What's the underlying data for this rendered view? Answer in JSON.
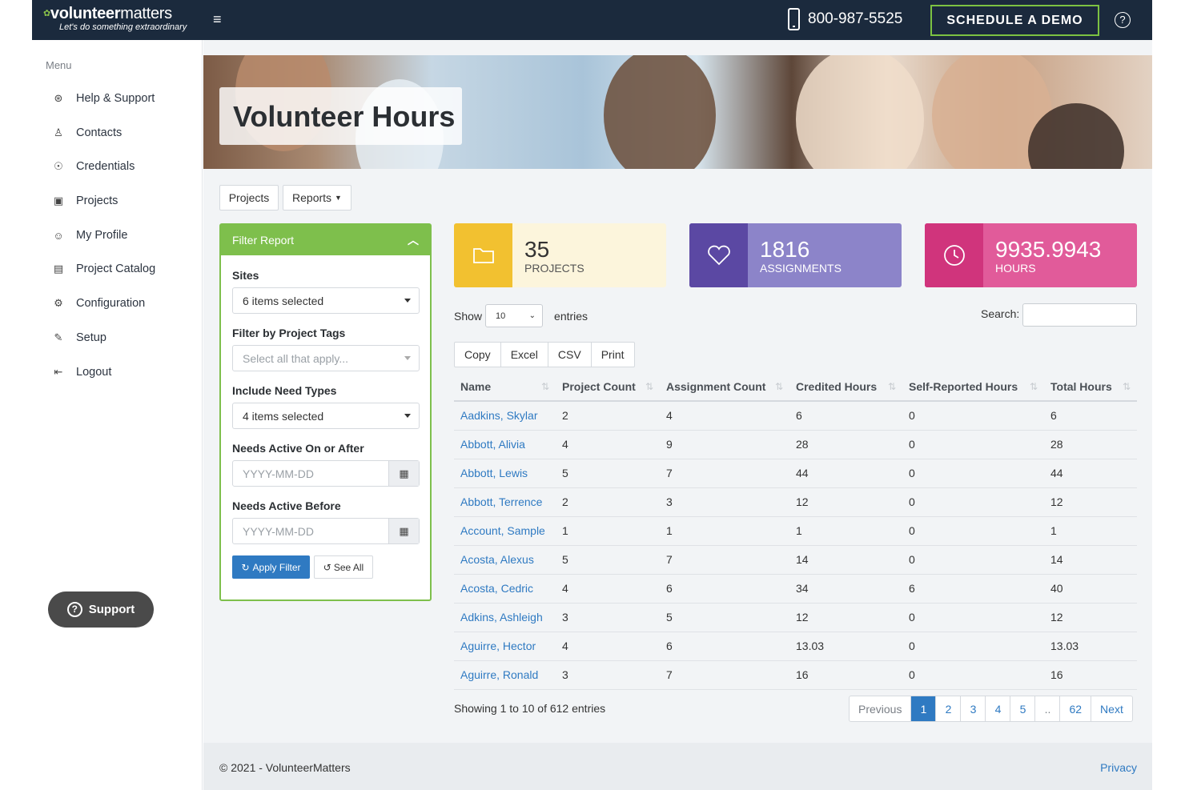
{
  "header": {
    "brand_bold": "volunteer",
    "brand_thin": "matters",
    "tagline": "Let's do something extraordinary",
    "phone": "800-987-5525",
    "demo_label": "SCHEDULE A DEMO",
    "help_symbol": "?"
  },
  "sidebar": {
    "menu_title": "Menu",
    "items": [
      {
        "label": "Help & Support",
        "icon": "lifebuoy-icon"
      },
      {
        "label": "Contacts",
        "icon": "contacts-icon"
      },
      {
        "label": "Credentials",
        "icon": "award-icon"
      },
      {
        "label": "Projects",
        "icon": "briefcase-icon"
      },
      {
        "label": "My Profile",
        "icon": "smiley-icon"
      },
      {
        "label": "Project Catalog",
        "icon": "book-icon"
      },
      {
        "label": "Configuration",
        "icon": "gear-icon"
      },
      {
        "label": "Setup",
        "icon": "wrench-icon"
      },
      {
        "label": "Logout",
        "icon": "logout-icon"
      }
    ],
    "support_label": "Support"
  },
  "page": {
    "title": "Volunteer Hours",
    "nav_projects": "Projects",
    "nav_reports": "Reports"
  },
  "filter": {
    "title": "Filter Report",
    "sites_label": "Sites",
    "sites_value": "6 items selected",
    "tags_label": "Filter by Project Tags",
    "tags_placeholder": "Select all that apply...",
    "need_types_label": "Include Need Types",
    "need_types_value": "4 items selected",
    "active_after_label": "Needs Active On or After",
    "active_before_label": "Needs Active Before",
    "date_placeholder": "YYYY-MM-DD",
    "apply_label": "Apply Filter",
    "see_all_label": "See All"
  },
  "stats": [
    {
      "value": "35",
      "label": "PROJECTS",
      "color": "#f2c130",
      "bg": "#fcf5dc",
      "icon": "folder-icon"
    },
    {
      "value": "1816",
      "label": "ASSIGNMENTS",
      "color": "#5b48a3",
      "bg": "#8c84c9",
      "icon": "heart-icon"
    },
    {
      "value": "9935.9943",
      "label": "HOURS",
      "color": "#d0347c",
      "bg": "#e15b9a",
      "icon": "clock-icon"
    }
  ],
  "table_controls": {
    "show_label": "Show",
    "page_size": "10",
    "entries_label": "entries",
    "search_label": "Search:",
    "export_buttons": [
      "Copy",
      "Excel",
      "CSV",
      "Print"
    ]
  },
  "table": {
    "columns": [
      "Name",
      "Project Count",
      "Assignment Count",
      "Credited Hours",
      "Self-Reported Hours",
      "Total Hours"
    ],
    "rows": [
      [
        "Aadkins, Skylar",
        "2",
        "4",
        "6",
        "0",
        "6"
      ],
      [
        "Abbott, Alivia",
        "4",
        "9",
        "28",
        "0",
        "28"
      ],
      [
        "Abbott, Lewis",
        "5",
        "7",
        "44",
        "0",
        "44"
      ],
      [
        "Abbott, Terrence",
        "2",
        "3",
        "12",
        "0",
        "12"
      ],
      [
        "Account, Sample",
        "1",
        "1",
        "1",
        "0",
        "1"
      ],
      [
        "Acosta, Alexus",
        "5",
        "7",
        "14",
        "0",
        "14"
      ],
      [
        "Acosta, Cedric",
        "4",
        "6",
        "34",
        "6",
        "40"
      ],
      [
        "Adkins, Ashleigh",
        "3",
        "5",
        "12",
        "0",
        "12"
      ],
      [
        "Aguirre, Hector",
        "4",
        "6",
        "13.03",
        "0",
        "13.03"
      ],
      [
        "Aguirre, Ronald",
        "3",
        "7",
        "16",
        "0",
        "16"
      ]
    ],
    "info": "Showing 1 to 10 of 612 entries"
  },
  "pagination": {
    "prev": "Previous",
    "pages": [
      "1",
      "2",
      "3",
      "4",
      "5",
      "..",
      "62"
    ],
    "active": "1",
    "next": "Next"
  },
  "footer": {
    "copyright": "© 2021 - VolunteerMatters",
    "privacy": "Privacy"
  }
}
